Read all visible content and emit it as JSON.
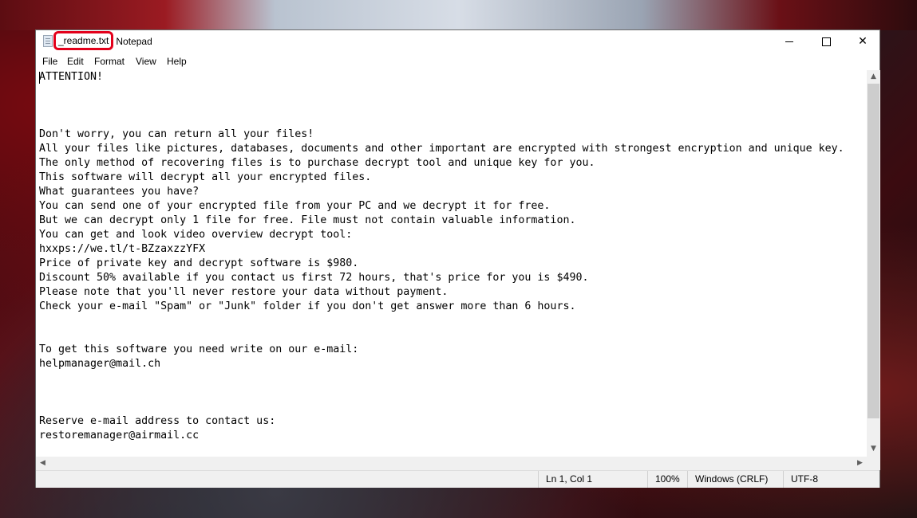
{
  "window": {
    "file_name": "_readme.txt",
    "app_name": "Notepad"
  },
  "menu": {
    "file": "File",
    "edit": "Edit",
    "format": "Format",
    "view": "View",
    "help": "Help"
  },
  "document": {
    "text": "ATTENTION!\n\n\n\nDon't worry, you can return all your files!\nAll your files like pictures, databases, documents and other important are encrypted with strongest encryption and unique key.\nThe only method of recovering files is to purchase decrypt tool and unique key for you.\nThis software will decrypt all your encrypted files.\nWhat guarantees you have?\nYou can send one of your encrypted file from your PC and we decrypt it for free.\nBut we can decrypt only 1 file for free. File must not contain valuable information.\nYou can get and look video overview decrypt tool:\nhxxps://we.tl/t-BZzaxzzYFX\nPrice of private key and decrypt software is $980.\nDiscount 50% available if you contact us first 72 hours, that's price for you is $490.\nPlease note that you'll never restore your data without payment.\nCheck your e-mail \"Spam\" or \"Junk\" folder if you don't get answer more than 6 hours.\n\n\nTo get this software you need write on our e-mail:\nhelpmanager@mail.ch\n\n\n\nReserve e-mail address to contact us:\nrestoremanager@airmail.cc"
  },
  "status": {
    "position": "Ln 1, Col 1",
    "zoom": "100%",
    "line_endings": "Windows (CRLF)",
    "encoding": "UTF-8"
  }
}
